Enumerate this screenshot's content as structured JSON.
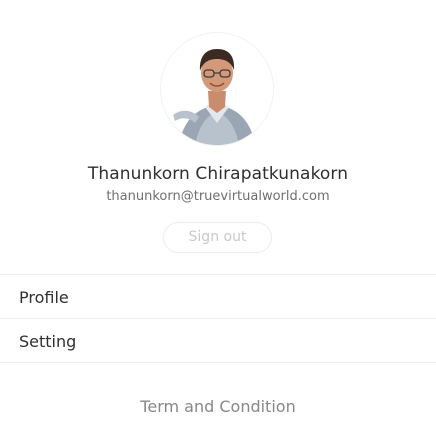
{
  "user": {
    "name": "Thanunkorn Chirapatkunakorn",
    "email": "thanunkorn@truevirtualworld.com"
  },
  "signout_label": "Sign out",
  "menu": {
    "items": [
      {
        "label": "Profile"
      },
      {
        "label": "Setting"
      }
    ]
  },
  "footer": {
    "terms_label": "Term and Condition"
  },
  "colors": {
    "name_text": "#2f2f2f",
    "email_text": "#6f6f6f",
    "signout_text": "#c9c9c9",
    "terms_text": "#878787",
    "divider": "#eeeeee"
  }
}
